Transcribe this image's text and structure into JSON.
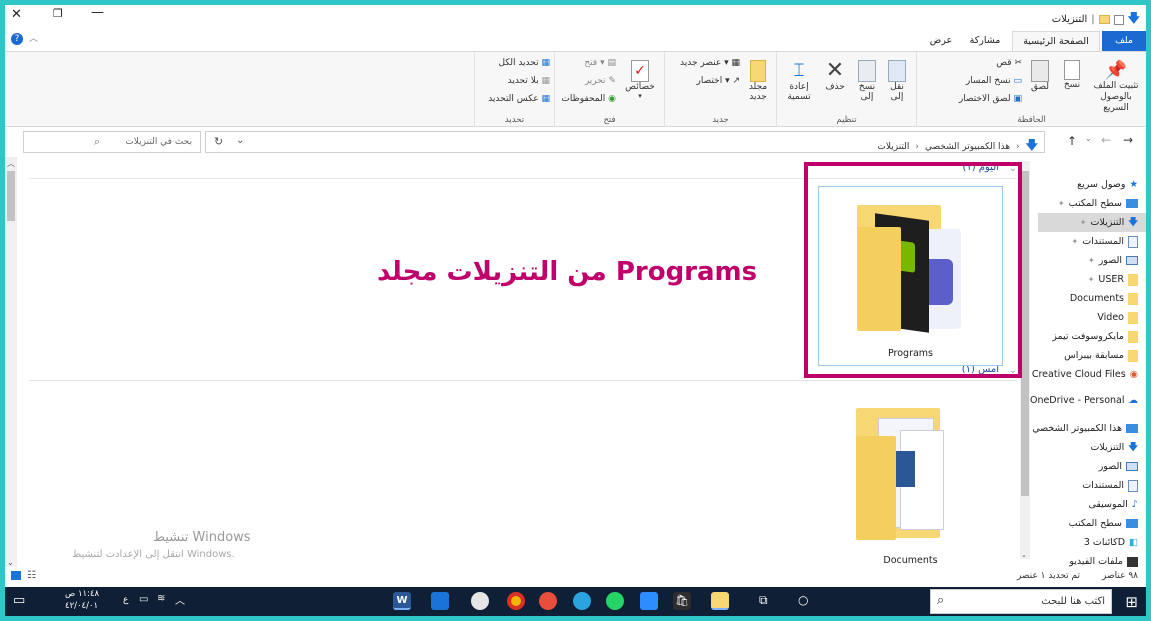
{
  "window": {
    "title": "التنزيلات"
  },
  "tabs": [
    "ملف",
    "الصفحة الرئيسية",
    "مشاركة",
    "عرض"
  ],
  "ribbon": {
    "clipboard": {
      "label": "الحافظة",
      "pin": "تثبيت الملف بالوصول السريع",
      "copy": "نسخ",
      "paste": "لصق",
      "cut": "قص",
      "copy_path": "نسخ المسار",
      "paste_shortcut": "لصق الاختصار"
    },
    "organize": {
      "label": "تنظيم",
      "move_to": "نقل إلى",
      "copy_to": "نسخ إلى",
      "delete": "حذف",
      "rename": "إعادة تسمية"
    },
    "new": {
      "label": "جديد",
      "new_folder": "مجلد جديد",
      "new_item": "عنصر جديد",
      "easy_access": "اختصار"
    },
    "open": {
      "label": "فتح",
      "properties": "خصائص",
      "open": "فتح",
      "edit": "تحرير",
      "history": "المحفوظات"
    },
    "select": {
      "label": "تحديد",
      "select_all": "تحديد الكل",
      "select_none": "بلا تحديد",
      "invert": "عكس التحديد"
    }
  },
  "address": {
    "path_pc": "هذا الكمبيوتر الشخصي",
    "path_current": "التنزيلات",
    "search_placeholder": "بحث في التنزيلات"
  },
  "nav": {
    "quick_access": "وصول سريع",
    "items": [
      "سطح المكتب",
      "التنزيلات",
      "المستندات",
      "الصور",
      "USER",
      "Documents",
      "Video",
      "مايكروسوفت تيمز",
      "مسابقة بيبراس"
    ],
    "cloud1": "Creative Cloud Files",
    "cloud2": "OneDrive - Personal",
    "pc": "هذا الكمبيوتر الشخصي",
    "pc_items": [
      "التنزيلات",
      "الصور",
      "المستندات",
      "الموسيقى",
      "سطح المكتب",
      "كائنات 3D",
      "ملفات الفيديو"
    ]
  },
  "content": {
    "group_today": "اليوم (١)",
    "group_yesterday": "أمس (١)",
    "item1": "Programs",
    "item2": "Documents",
    "annotation": "من التنزيلات مجلد Programs",
    "activation_title": "تنشيط Windows",
    "activation_sub": "انتقل إلى الإعدادت لتنشيط Windows."
  },
  "status": {
    "count": "٩٨ عناصر",
    "selected": "تم تحديد ١ عنصر"
  },
  "taskbar": {
    "search": "اكتب هنا للبحث",
    "time": "١١:٤٨ ص",
    "date": "٤٢/٠٤/٠١",
    "lang": "ع"
  },
  "colors": {
    "accent": "#0a64c8",
    "highlight": "#c0006a",
    "teal": "#2ec6c6"
  }
}
